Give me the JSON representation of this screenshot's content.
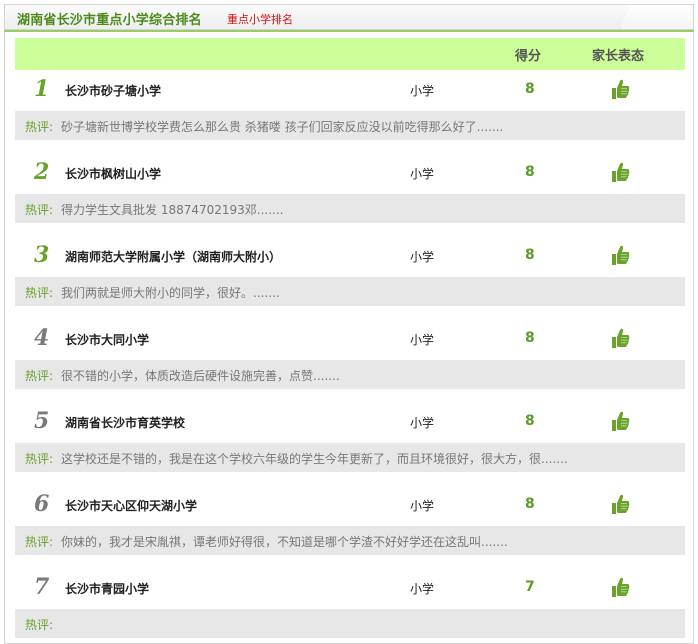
{
  "header": {
    "title": "湖南省长沙市重点小学综合排名",
    "subtitle": "重点小学排名"
  },
  "columns": {
    "score": "得分",
    "attitude": "家长表态"
  },
  "comment_label": "热评:",
  "colors": {
    "accent_green": "#5c9c2a",
    "header_band": "#ccff99",
    "comment_bg": "#e7e7e7",
    "subtitle_red": "#cc1111",
    "rank_top3": "#6aa329",
    "rank_other": "#7a7a7a"
  },
  "thumb_icon": "thumbs-up-icon",
  "rows": [
    {
      "rank": "1",
      "name": "长沙市砂子塘小学",
      "type": "小学",
      "score": "8",
      "comment": "砂子塘新世博学校学费怎么那么贵 杀猪喽 孩子们回家反应没以前吃得那么好了......."
    },
    {
      "rank": "2",
      "name": "长沙市枫树山小学",
      "type": "小学",
      "score": "8",
      "comment": "得力学生文具批发 18874702193邓......."
    },
    {
      "rank": "3",
      "name": "湖南师范大学附属小学（湖南师大附小）",
      "type": "小学",
      "score": "8",
      "comment": "我们两就是师大附小的同学，很好。......."
    },
    {
      "rank": "4",
      "name": "长沙市大同小学",
      "type": "小学",
      "score": "8",
      "comment": "很不错的小学，体质改造后硬件设施完善，点赞......."
    },
    {
      "rank": "5",
      "name": "湖南省长沙市育英学校",
      "type": "小学",
      "score": "8",
      "comment": "这学校还是不错的，我是在这个学校六年级的学生今年更新了，而且环境很好，很大方，很......."
    },
    {
      "rank": "6",
      "name": "长沙市天心区仰天湖小学",
      "type": "小学",
      "score": "8",
      "comment": "你妹的，我才是宋胤祺，谭老师好得很，不知道是哪个学渣不好好学还在这乱叫......."
    },
    {
      "rank": "7",
      "name": "长沙市青园小学",
      "type": "小学",
      "score": "7",
      "comment": ""
    }
  ]
}
